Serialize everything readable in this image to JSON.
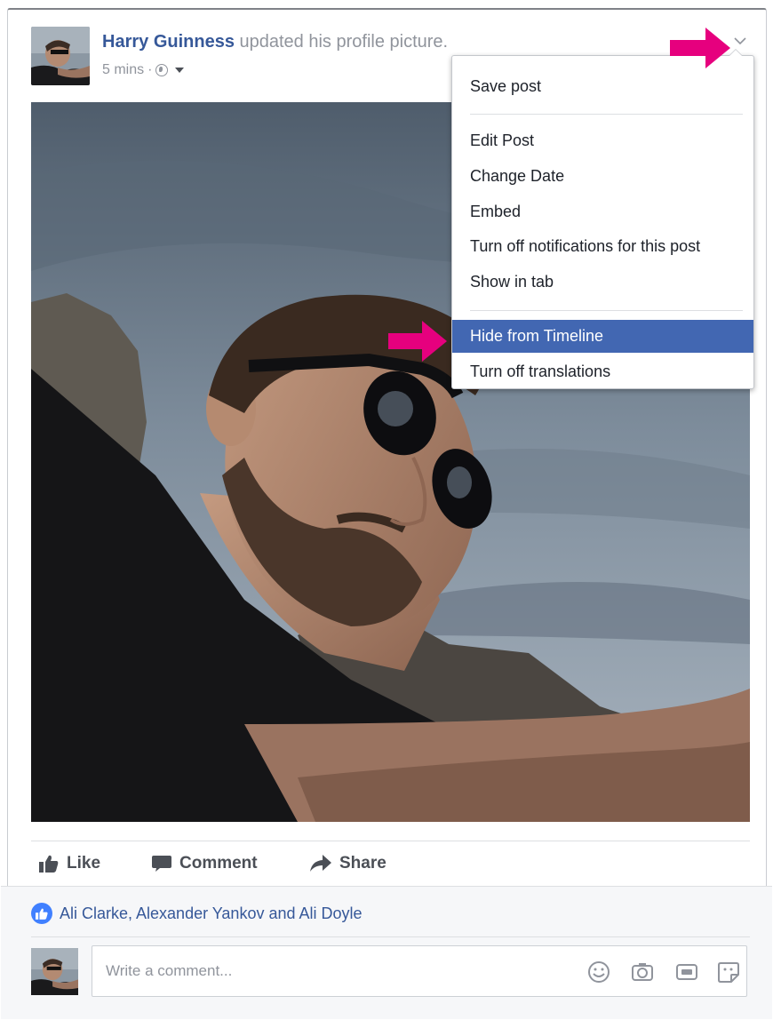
{
  "post": {
    "author": "Harry Guinness",
    "action_text": " updated his profile picture.",
    "time": "5 mins",
    "meta_separator": "·"
  },
  "menu": {
    "items": [
      {
        "label": "Save post"
      },
      {
        "label": "Edit Post"
      },
      {
        "label": "Change Date"
      },
      {
        "label": "Embed"
      },
      {
        "label": "Turn off notifications for this post"
      },
      {
        "label": "Show in tab"
      },
      {
        "label": "Hide from Timeline",
        "highlighted": true
      },
      {
        "label": "Turn off translations"
      }
    ]
  },
  "actions": {
    "like": "Like",
    "comment": "Comment",
    "share": "Share"
  },
  "likes": {
    "names": "Ali Clarke, Alexander Yankov and Ali Doyle"
  },
  "comment_box": {
    "placeholder": "Write a comment..."
  },
  "icons": {
    "privacy": "globe-icon",
    "audience_caret": "caret-down-icon",
    "post_options": "chevron-down-icon",
    "like": "thumbs-up-icon",
    "comment": "speech-bubble-icon",
    "share": "share-arrow-icon",
    "like_badge": "like-badge-icon",
    "emoji": "smiley-icon",
    "photo": "camera-icon",
    "gif": "gif-icon",
    "sticker": "sticker-icon",
    "annotation": "pink-arrow-icon"
  },
  "colors": {
    "facebook_blue": "#4267b2",
    "link_blue": "#365899",
    "annotation_pink": "#e6007e",
    "like_badge_blue": "#4080ff"
  }
}
